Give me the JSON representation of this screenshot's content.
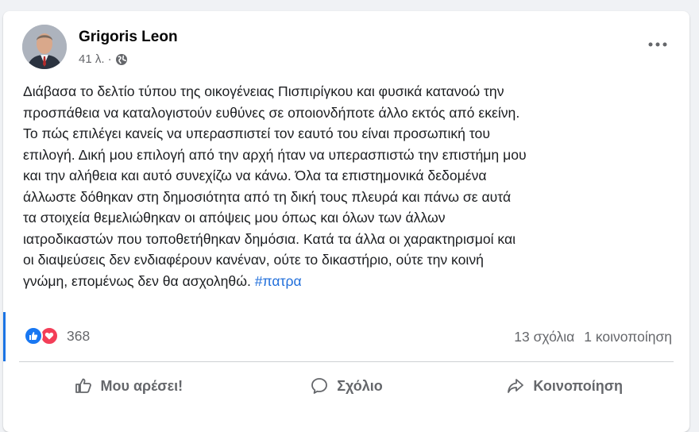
{
  "post": {
    "author": "Grigoris Leon",
    "time": "41 λ. ·",
    "privacy_icon": "globe-icon",
    "text": "Διάβασα το δελτίο τύπου της οικογένειας Πισπιρίγκου και φυσικά κατανοώ την\nπροσπάθεια να καταλογιστούν ευθύνες σε οποιονδήποτε άλλο εκτός από εκείνη.\nΤο πώς επιλέγει κανείς να υπερασπιστεί τον εαυτό του είναι προσωπική του\nεπιλογή. Δική μου επιλογή από την αρχή ήταν να υπερασπιστώ την επιστήμη μου\nκαι την αλήθεια και αυτό συνεχίζω να κάνω. Όλα τα επιστημονικά δεδομένα\nάλλωστε δόθηκαν στη δημοσιότητα από τη δική τους πλευρά και πάνω σε αυτά\nτα στοιχεία θεμελιώθηκαν οι απόψεις μου όπως και όλων των άλλων\nιατροδικαστών που τοποθετήθηκαν δημόσια. Κατά τα άλλα οι χαρακτηρισμοί και\nοι διαψεύσεις δεν ενδιαφέρουν κανέναν, ούτε το δικαστήριο, ούτε την κοινή\nγνώμη, επομένως δεν θα ασχοληθώ. ",
    "hashtag": "#πατρα"
  },
  "stats": {
    "reaction_count": "368",
    "comments": "13 σχόλια",
    "shares": "1 κοινοποίηση"
  },
  "actions": {
    "like_label": "Μου αρέσει!",
    "comment_label": "Σχόλιο",
    "share_label": "Κοινοποίηση"
  },
  "colors": {
    "accent": "#1877f2",
    "love": "#f33e58",
    "hashtag": "#216fdb",
    "secondary_text": "#65676b"
  }
}
